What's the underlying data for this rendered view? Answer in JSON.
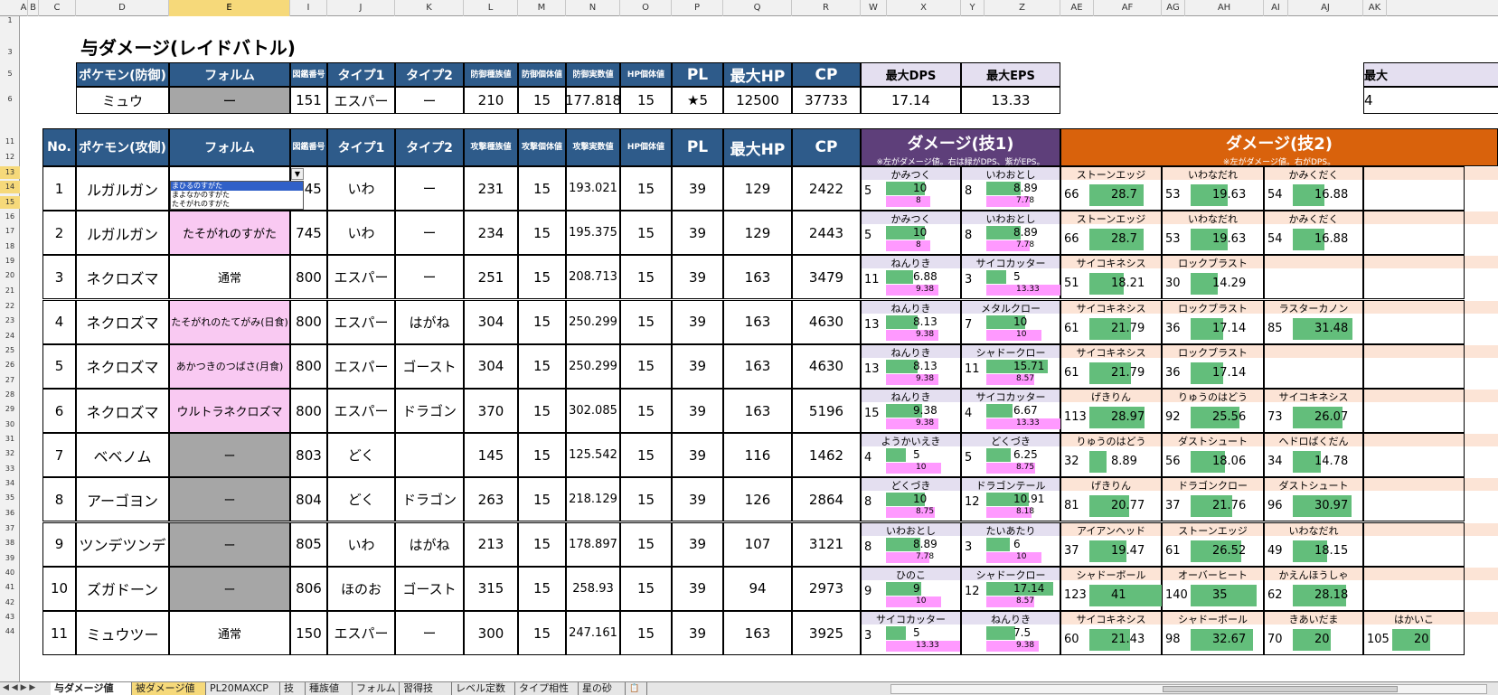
{
  "columns": [
    "A",
    "B",
    "C",
    "D",
    "E",
    "I",
    "J",
    "K",
    "L",
    "M",
    "N",
    "O",
    "P",
    "Q",
    "R",
    "W",
    "X",
    "Y",
    "Z",
    "AE",
    "AF",
    "AG",
    "AH",
    "AI",
    "AJ",
    "AK"
  ],
  "selected_column": "E",
  "row_numbers": [
    "1",
    "3",
    "5",
    "6",
    "11",
    "12",
    "13",
    "14",
    "15",
    "16",
    "17",
    "18",
    "19",
    "20",
    "21",
    "22",
    "23",
    "24",
    "25",
    "26",
    "27",
    "28",
    "29",
    "30",
    "31",
    "32",
    "33",
    "34",
    "35",
    "36",
    "37",
    "38",
    "39",
    "40",
    "41",
    "42",
    "43",
    "44"
  ],
  "selected_rows": [
    "13",
    "14",
    "15"
  ],
  "title": "与ダメージ(レイドバトル)",
  "defender": {
    "headers": [
      "ポケモン(防御)",
      "フォルム",
      "図鑑番号",
      "タイプ1",
      "タイプ2",
      "防御種族値",
      "防御個体値",
      "防御実数値",
      "HP個体値",
      "PL",
      "最大HP",
      "CP"
    ],
    "values": [
      "ミュウ",
      "ー",
      "151",
      "エスパー",
      "ー",
      "210",
      "15",
      "177.818",
      "15",
      "★5",
      "12500",
      "37733"
    ]
  },
  "max_stats": {
    "headers": [
      "最大DPS",
      "最大EPS"
    ],
    "values": [
      "17.14",
      "13.33"
    ],
    "cut_header": "最大",
    "cut_value": "4"
  },
  "attacker_headers": [
    "No.",
    "ポケモン(攻側)",
    "フォルム",
    "図鑑番号",
    "タイプ1",
    "タイプ2",
    "攻撃種族値",
    "攻撃個体値",
    "攻撃実数値",
    "HP個体値",
    "PL",
    "最大HP",
    "CP"
  ],
  "skill1_header": {
    "title": "ダメージ(技1)",
    "sub": "※左がダメージ値。右は緑がDPS、紫がEPS。",
    "color": "#5e3f7a"
  },
  "skill2_header": {
    "title": "ダメージ(技2)",
    "sub": "※左がダメージ値。右がDPS。",
    "color": "#d9620c"
  },
  "dropdown": {
    "options": [
      "まひるのすがた",
      "まよなかのすがた",
      "たそがれのすがた"
    ],
    "selected_index": 0,
    "arrow": "▼"
  },
  "rows": [
    {
      "no": "1",
      "name": "ルガルガン",
      "form": "",
      "formType": "dropdown",
      "dex": "745",
      "t1": "いわ",
      "t2": "ー",
      "atk": "231",
      "iv": "15",
      "real": "193.021",
      "hpiv": "15",
      "pl": "39",
      "hp": "129",
      "cp": "2422",
      "fast": [
        {
          "n": "かみつく",
          "p": "5",
          "d": 10,
          "e": 8
        },
        {
          "n": "いわおとし",
          "p": "8",
          "d": 8.89,
          "e": 7.78
        }
      ],
      "charge": [
        {
          "n": "ストーンエッジ",
          "p": "66",
          "d": 28.7
        },
        {
          "n": "いわなだれ",
          "p": "53",
          "d": 19.63
        },
        {
          "n": "かみくだく",
          "p": "54",
          "d": 16.88
        }
      ]
    },
    {
      "no": "2",
      "name": "ルガルガン",
      "form": "たそがれのすがた",
      "formType": "pink",
      "dex": "745",
      "t1": "いわ",
      "t2": "ー",
      "atk": "234",
      "iv": "15",
      "real": "195.375",
      "hpiv": "15",
      "pl": "39",
      "hp": "129",
      "cp": "2443",
      "fast": [
        {
          "n": "かみつく",
          "p": "5",
          "d": 10,
          "e": 8
        },
        {
          "n": "いわおとし",
          "p": "8",
          "d": 8.89,
          "e": 7.78
        }
      ],
      "charge": [
        {
          "n": "ストーンエッジ",
          "p": "66",
          "d": 28.7
        },
        {
          "n": "いわなだれ",
          "p": "53",
          "d": 19.63
        },
        {
          "n": "かみくだく",
          "p": "54",
          "d": 16.88
        }
      ]
    },
    {
      "no": "3",
      "name": "ネクロズマ",
      "form": "通常",
      "formType": "white",
      "dex": "800",
      "t1": "エスパー",
      "t2": "ー",
      "atk": "251",
      "iv": "15",
      "real": "208.713",
      "hpiv": "15",
      "pl": "39",
      "hp": "163",
      "cp": "3479",
      "fast": [
        {
          "n": "ねんりき",
          "p": "11",
          "d": 6.88,
          "e": 9.38
        },
        {
          "n": "サイコカッター",
          "p": "3",
          "d": 5,
          "e": 13.33
        }
      ],
      "charge": [
        {
          "n": "サイコキネシス",
          "p": "51",
          "d": 18.21
        },
        {
          "n": "ロックブラスト",
          "p": "30",
          "d": 14.29
        }
      ]
    },
    {
      "no": "4",
      "name": "ネクロズマ",
      "form": "たそがれのたてがみ(日食)",
      "formType": "pink",
      "dex": "800",
      "t1": "エスパー",
      "t2": "はがね",
      "atk": "304",
      "iv": "15",
      "real": "250.299",
      "hpiv": "15",
      "pl": "39",
      "hp": "163",
      "cp": "4630",
      "fast": [
        {
          "n": "ねんりき",
          "p": "13",
          "d": 8.13,
          "e": 9.38
        },
        {
          "n": "メタルクロー",
          "p": "7",
          "d": 10,
          "e": 10
        }
      ],
      "charge": [
        {
          "n": "サイコキネシス",
          "p": "61",
          "d": 21.79
        },
        {
          "n": "ロックブラスト",
          "p": "36",
          "d": 17.14
        },
        {
          "n": "ラスターカノン",
          "p": "85",
          "d": 31.48
        }
      ]
    },
    {
      "no": "5",
      "name": "ネクロズマ",
      "form": "あかつきのつばさ(月食)",
      "formType": "pink",
      "dex": "800",
      "t1": "エスパー",
      "t2": "ゴースト",
      "atk": "304",
      "iv": "15",
      "real": "250.299",
      "hpiv": "15",
      "pl": "39",
      "hp": "163",
      "cp": "4630",
      "fast": [
        {
          "n": "ねんりき",
          "p": "13",
          "d": 8.13,
          "e": 9.38
        },
        {
          "n": "シャドークロー",
          "p": "11",
          "d": 15.71,
          "e": 8.57
        }
      ],
      "charge": [
        {
          "n": "サイコキネシス",
          "p": "61",
          "d": 21.79
        },
        {
          "n": "ロックブラスト",
          "p": "36",
          "d": 17.14
        }
      ]
    },
    {
      "no": "6",
      "name": "ネクロズマ",
      "form": "ウルトラネクロズマ",
      "formType": "pink",
      "dex": "800",
      "t1": "エスパー",
      "t2": "ドラゴン",
      "atk": "370",
      "iv": "15",
      "real": "302.085",
      "hpiv": "15",
      "pl": "39",
      "hp": "163",
      "cp": "5196",
      "fast": [
        {
          "n": "ねんりき",
          "p": "15",
          "d": 9.38,
          "e": 9.38
        },
        {
          "n": "サイコカッター",
          "p": "4",
          "d": 6.67,
          "e": 13.33
        }
      ],
      "charge": [
        {
          "n": "げきりん",
          "p": "113",
          "d": 28.97
        },
        {
          "n": "りゅうのはどう",
          "p": "92",
          "d": 25.56
        },
        {
          "n": "サイコキネシス",
          "p": "73",
          "d": 26.07
        }
      ]
    },
    {
      "no": "7",
      "name": "ベベノム",
      "form": "ー",
      "formType": "gray",
      "dex": "803",
      "t1": "どく",
      "t2": "",
      "atk": "145",
      "iv": "15",
      "real": "125.542",
      "hpiv": "15",
      "pl": "39",
      "hp": "116",
      "cp": "1462",
      "fast": [
        {
          "n": "ようかいえき",
          "p": "4",
          "d": 5,
          "e": 10
        },
        {
          "n": "どくづき",
          "p": "5",
          "d": 6.25,
          "e": 8.75
        }
      ],
      "charge": [
        {
          "n": "りゅうのはどう",
          "p": "32",
          "d": 8.89
        },
        {
          "n": "ダストシュート",
          "p": "56",
          "d": 18.06
        },
        {
          "n": "ヘドロばくだん",
          "p": "34",
          "d": 14.78
        }
      ]
    },
    {
      "no": "8",
      "name": "アーゴヨン",
      "form": "ー",
      "formType": "gray",
      "dex": "804",
      "t1": "どく",
      "t2": "ドラゴン",
      "atk": "263",
      "iv": "15",
      "real": "218.129",
      "hpiv": "15",
      "pl": "39",
      "hp": "126",
      "cp": "2864",
      "fast": [
        {
          "n": "どくづき",
          "p": "8",
          "d": 10,
          "e": 8.75
        },
        {
          "n": "ドラゴンテール",
          "p": "12",
          "d": 10.91,
          "e": 8.18
        }
      ],
      "charge": [
        {
          "n": "げきりん",
          "p": "81",
          "d": 20.77
        },
        {
          "n": "ドラゴンクロー",
          "p": "37",
          "d": 21.76
        },
        {
          "n": "ダストシュート",
          "p": "96",
          "d": 30.97
        }
      ]
    },
    {
      "no": "9",
      "name": "ツンデツンデ",
      "form": "ー",
      "formType": "gray",
      "dex": "805",
      "t1": "いわ",
      "t2": "はがね",
      "atk": "213",
      "iv": "15",
      "real": "178.897",
      "hpiv": "15",
      "pl": "39",
      "hp": "107",
      "cp": "3121",
      "fast": [
        {
          "n": "いわおとし",
          "p": "8",
          "d": 8.89,
          "e": 7.78
        },
        {
          "n": "たいあたり",
          "p": "3",
          "d": 6,
          "e": 10
        }
      ],
      "charge": [
        {
          "n": "アイアンヘッド",
          "p": "37",
          "d": 19.47
        },
        {
          "n": "ストーンエッジ",
          "p": "61",
          "d": 26.52
        },
        {
          "n": "いわなだれ",
          "p": "49",
          "d": 18.15
        }
      ]
    },
    {
      "no": "10",
      "name": "ズガドーン",
      "form": "ー",
      "formType": "gray",
      "dex": "806",
      "t1": "ほのお",
      "t2": "ゴースト",
      "atk": "315",
      "iv": "15",
      "real": "258.93",
      "hpiv": "15",
      "pl": "39",
      "hp": "94",
      "cp": "2973",
      "fast": [
        {
          "n": "ひのこ",
          "p": "9",
          "d": 9,
          "e": 10
        },
        {
          "n": "シャドークロー",
          "p": "12",
          "d": 17.14,
          "e": 8.57
        }
      ],
      "charge": [
        {
          "n": "シャドーボール",
          "p": "123",
          "d": 41
        },
        {
          "n": "オーバーヒート",
          "p": "140",
          "d": 35
        },
        {
          "n": "かえんほうしゃ",
          "p": "62",
          "d": 28.18
        }
      ]
    },
    {
      "no": "11",
      "name": "ミュウツー",
      "form": "通常",
      "formType": "white",
      "dex": "150",
      "t1": "エスパー",
      "t2": "ー",
      "atk": "300",
      "iv": "15",
      "real": "247.161",
      "hpiv": "15",
      "pl": "39",
      "hp": "163",
      "cp": "3925",
      "fast": [
        {
          "n": "サイコカッター",
          "p": "3",
          "d": 5,
          "e": 13.33
        },
        {
          "n": "ねんりき",
          "p": "",
          "d": 7.5,
          "e": 9.38
        }
      ],
      "charge": [
        {
          "n": "サイコキネシス",
          "p": "60",
          "d": 21.43
        },
        {
          "n": "シャドーボール",
          "p": "98",
          "d": 32.67
        },
        {
          "n": "きあいだま",
          "p": "70",
          "d": 20
        },
        {
          "n": "はかいこ",
          "p": "105",
          "d": 20
        }
      ]
    }
  ],
  "sheet_tabs": [
    "与ダメージ値",
    "被ダメージ値",
    "PL20MAXCP",
    "技",
    "種族値",
    "フォルム",
    "習得技",
    "レベル定数",
    "タイプ相性",
    "星の砂"
  ],
  "active_tab": 0,
  "highlighted_tab": 1,
  "tab_nav": "◀ ◀ ▶ ▶",
  "colors": {
    "header_blue": "#2e5b8a",
    "lavender": "#e4dff0",
    "pink": "#f9c9f2",
    "gray": "#a6a6a6",
    "dps_green": "#63be7b",
    "eps_pink": "#ff99ff",
    "peach": "#fce4d6"
  }
}
